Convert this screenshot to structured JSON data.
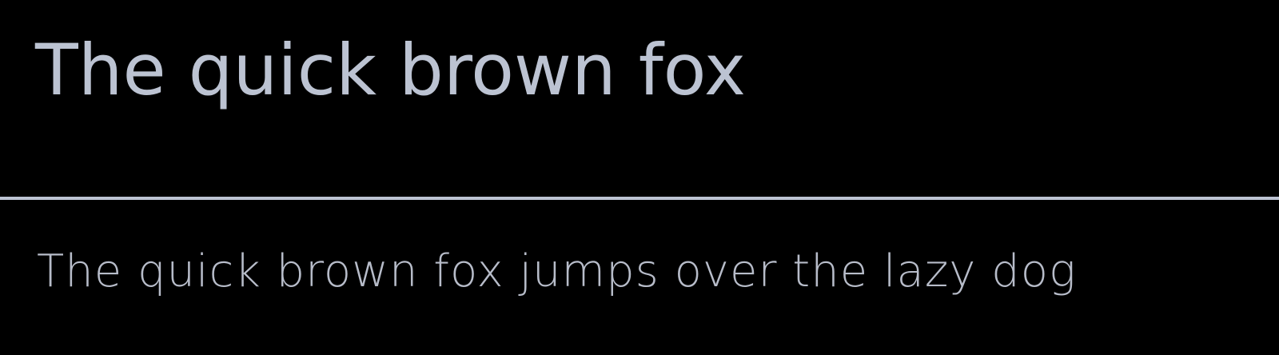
{
  "specimen": {
    "heading_text": "The quick brown fox",
    "sample_text": "The quick brown fox jumps over the lazy dog"
  },
  "colors": {
    "background": "#000000",
    "heading_text": "#bcc3d2",
    "divider": "#bcc3d2",
    "sample_text": "#b7bcc9"
  }
}
